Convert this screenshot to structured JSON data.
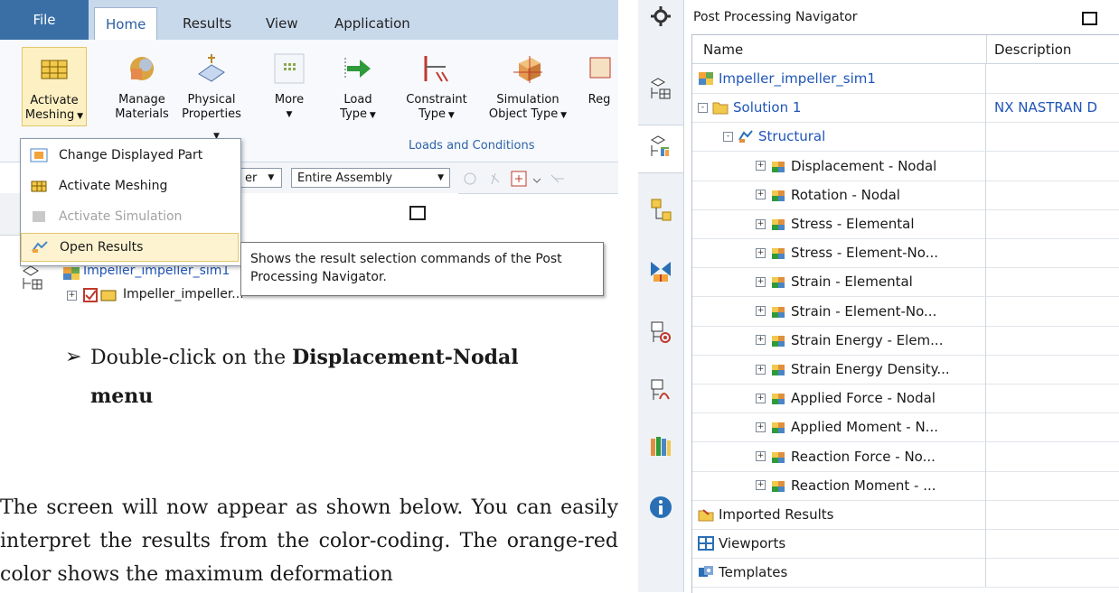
{
  "ribbon": {
    "tabs": {
      "file": "File",
      "home": "Home",
      "results": "Results",
      "view": "View",
      "application": "Application"
    },
    "buttons": {
      "activate_meshing": "Activate",
      "activate_meshing2": "Meshing",
      "manage_materials": "Manage",
      "manage_materials2": "Materials",
      "physical_properties": "Physical",
      "physical_properties2": "Properties",
      "more": "More",
      "load_type": "Load",
      "load_type2": "Type",
      "constraint_type": "Constraint",
      "constraint_type2": "Type",
      "simulation_object_type": "Simulation",
      "simulation_object_type2": "Object Type",
      "reg": "Reg"
    },
    "group_label": "Loads and Conditions"
  },
  "dropdown": {
    "items": [
      {
        "label": "Change Displayed Part"
      },
      {
        "label": "Activate Meshing"
      },
      {
        "label": "Activate Simulation"
      },
      {
        "label": "Open Results"
      }
    ]
  },
  "toolbar2": {
    "filter_partial": "er",
    "scope": "Entire Assembly"
  },
  "tooltip": {
    "text": "Shows the result selection commands of the Post Processing Navigator."
  },
  "left_tree": {
    "root": "Impeller_impeller_sim1",
    "child": "Impeller_impeller..."
  },
  "doc": {
    "bullet_pre": "Double-click on the ",
    "bullet_bold": "Displacement-Nodal",
    "bullet_bold2": "menu",
    "para": "The screen will now appear as shown below. You can easily interpret the results from the color-coding. The orange-red color shows the maximum deformation"
  },
  "navigator": {
    "title": "Post Processing Navigator",
    "columns": {
      "name": "Name",
      "description": "Description"
    },
    "rows": [
      {
        "label": "Impeller_impeller_sim1",
        "desc": ""
      },
      {
        "label": "Solution 1",
        "desc": "NX NASTRAN D"
      },
      {
        "label": "Structural",
        "desc": ""
      },
      {
        "label": "Displacement - Nodal",
        "desc": ""
      },
      {
        "label": "Rotation - Nodal",
        "desc": ""
      },
      {
        "label": "Stress - Elemental",
        "desc": ""
      },
      {
        "label": "Stress - Element-No...",
        "desc": ""
      },
      {
        "label": "Strain - Elemental",
        "desc": ""
      },
      {
        "label": "Strain - Element-No...",
        "desc": ""
      },
      {
        "label": "Strain Energy - Elem...",
        "desc": ""
      },
      {
        "label": "Strain Energy Density...",
        "desc": ""
      },
      {
        "label": "Applied Force - Nodal",
        "desc": ""
      },
      {
        "label": "Applied Moment - N...",
        "desc": ""
      },
      {
        "label": "Reaction Force - No...",
        "desc": ""
      },
      {
        "label": "Reaction Moment - ...",
        "desc": ""
      },
      {
        "label": "Imported Results",
        "desc": ""
      },
      {
        "label": "Viewports",
        "desc": ""
      },
      {
        "label": "Templates",
        "desc": ""
      }
    ]
  }
}
